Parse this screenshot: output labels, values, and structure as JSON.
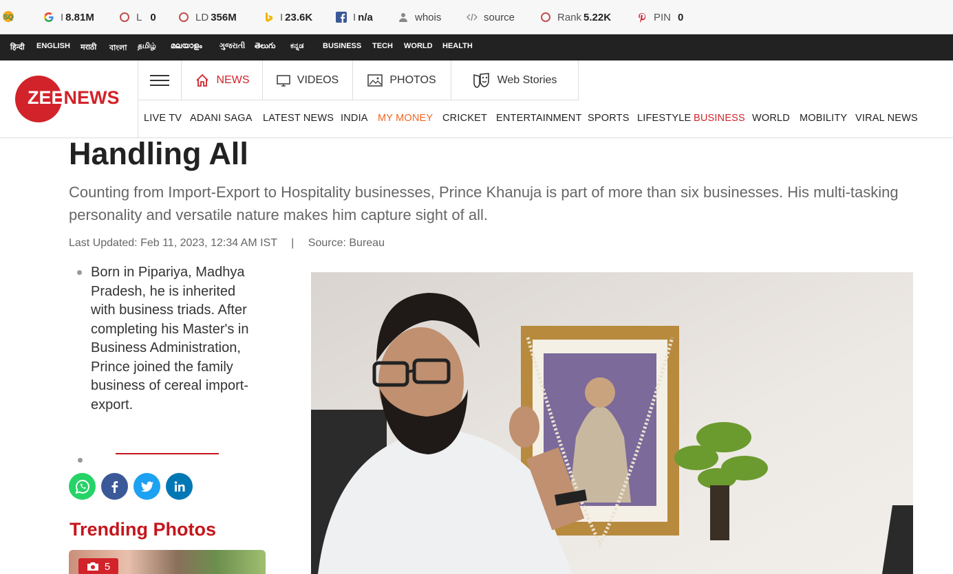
{
  "seo_bar": {
    "items": [
      {
        "icon": "google-icon",
        "label": "I",
        "value": "8.81M"
      },
      {
        "icon": "circle-icon",
        "label": "L",
        "value": "0"
      },
      {
        "icon": "circle-icon",
        "label": "LD",
        "value": "356M"
      },
      {
        "icon": "bing-icon",
        "label": "I",
        "value": "23.6K"
      },
      {
        "icon": "facebook-icon",
        "label": "I",
        "value": "n/a"
      },
      {
        "icon": "user-icon",
        "label": "whois",
        "value": ""
      },
      {
        "icon": "code-icon",
        "label": "source",
        "value": ""
      },
      {
        "icon": "circle-icon",
        "label": "Rank",
        "value": "5.22K"
      },
      {
        "icon": "pinterest-icon",
        "label": "PIN",
        "value": "0"
      }
    ]
  },
  "lang_bar": {
    "items": [
      "हिन्दी",
      "ENGLISH",
      "मराठी",
      "বাংলা",
      "தமிழ்",
      "മലയാളം",
      "ગુજરાતી",
      "తెలుగు",
      "ಕನ್ನಡ",
      "BUSINESS",
      "TECH",
      "WORLD",
      "HEALTH"
    ]
  },
  "header": {
    "logo": {
      "zee": "ZEE",
      "news": "NEWS"
    },
    "topnav": [
      {
        "icon": "home-icon",
        "label": "NEWS"
      },
      {
        "icon": "monitor-icon",
        "label": "VIDEOS"
      },
      {
        "icon": "image-icon",
        "label": "PHOTOS"
      },
      {
        "icon": "web-stories-icon",
        "label": "Web Stories"
      }
    ],
    "subnav": [
      "LIVE TV",
      "ADANI SAGA",
      "LATEST NEWS",
      "INDIA",
      "MY MONEY",
      "CRICKET",
      "ENTERTAINMENT",
      "SPORTS",
      "LIFESTYLE",
      "BUSINESS",
      "WORLD",
      "MOBILITY",
      "VIRAL NEWS"
    ],
    "colors": {
      "accent": "#d2232a",
      "my_money": "#f26522"
    }
  },
  "article": {
    "title_line": "Handling All",
    "summary": "Counting from Import-Export to Hospitality businesses, Prince Khanuja is part of more than six businesses. His multi-tasking personality and versatile nature makes him capture sight of all.",
    "updated": "Last Updated: Feb 11, 2023, 12:34 AM IST",
    "separator": "|",
    "source": "Source: Bureau",
    "highlights": [
      "Born in Pipariya, Madhya Pradesh, he is inherited with business triads. After completing his Master's in Business Administration, Prince joined the family business of cereal import-export."
    ]
  },
  "share": [
    "whatsapp-icon",
    "facebook-icon",
    "twitter-icon",
    "linkedin-icon"
  ],
  "trending": {
    "heading": "Trending Photos",
    "photo_count": "5"
  }
}
